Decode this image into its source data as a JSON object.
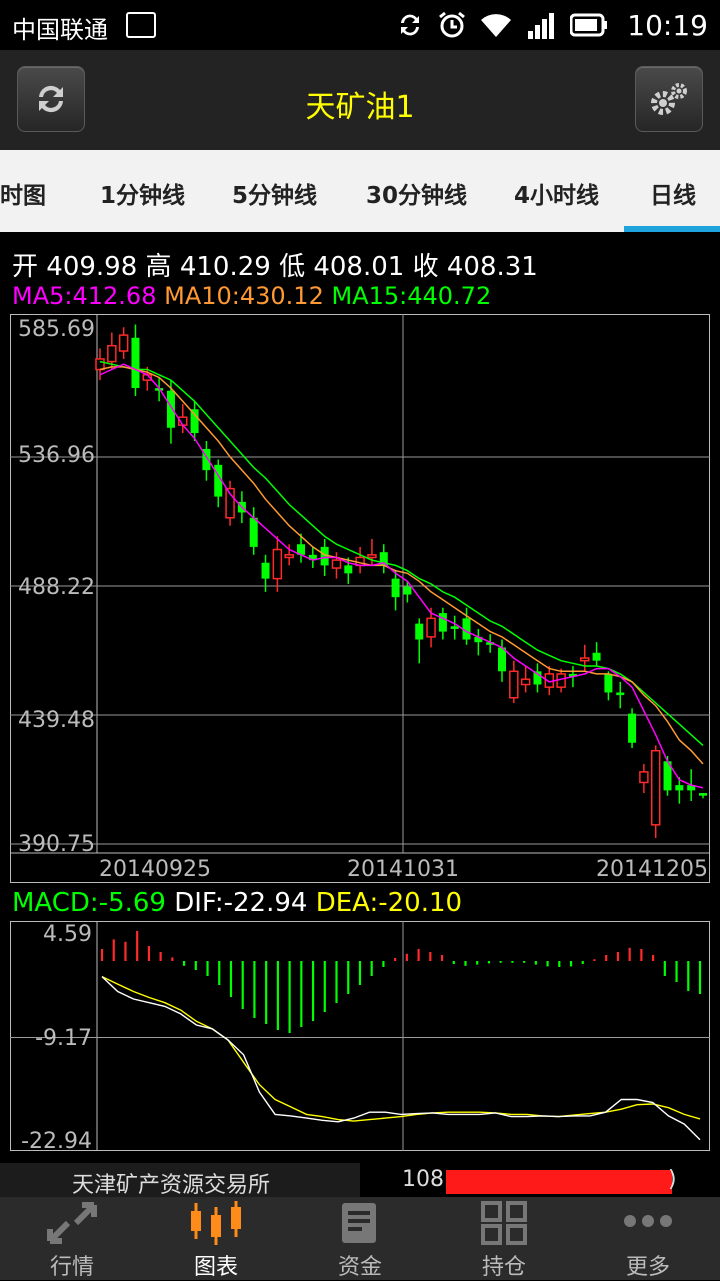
{
  "status_bar": {
    "carrier": "中国联通",
    "time": "10:19"
  },
  "title_bar": {
    "title": "天矿油1",
    "refresh_icon": "refresh-icon",
    "settings_icon": "settings-gear-icon"
  },
  "tabs": [
    {
      "label": "时图"
    },
    {
      "label": "1分钟线"
    },
    {
      "label": "5分钟线"
    },
    {
      "label": "30分钟线"
    },
    {
      "label": "4小时线"
    },
    {
      "label": "日线",
      "active": true
    }
  ],
  "ohlc": {
    "open_label": "开",
    "open": "409.98",
    "high_label": "高",
    "high": "410.29",
    "low_label": "低",
    "low": "408.01",
    "close_label": "收",
    "close": "408.31"
  },
  "ma": {
    "ma5": "MA5:412.68",
    "ma10": "MA10:430.12",
    "ma15": "MA15:440.72",
    "ma5_color": "#ff00ff",
    "ma10_color": "#ff9933",
    "ma15_color": "#00ff00"
  },
  "macd": {
    "macd": "MACD:-5.69",
    "dif": "DIF:-22.94",
    "dea": "DEA:-20.10",
    "macd_color": "#00ff00",
    "dif_color": "#ffffff",
    "dea_color": "#ffff00"
  },
  "chart_data": [
    {
      "type": "candlestick",
      "y_ticks": [
        "585.69",
        "536.96",
        "488.22",
        "439.48",
        "390.75"
      ],
      "ylim": [
        390.75,
        585.69
      ],
      "x_labels": [
        "20140925",
        "20141031",
        "20141205"
      ],
      "up_color": "#ff2a2a",
      "down_color": "#00ff00",
      "candles": [
        {
          "o": 570,
          "c": 574,
          "h": 578,
          "l": 566
        },
        {
          "o": 573,
          "c": 579,
          "h": 584,
          "l": 570
        },
        {
          "o": 577,
          "c": 583,
          "h": 586,
          "l": 574
        },
        {
          "o": 582,
          "c": 563,
          "h": 587,
          "l": 560
        },
        {
          "o": 566,
          "c": 568,
          "h": 571,
          "l": 562
        },
        {
          "o": 563,
          "c": 562,
          "h": 567,
          "l": 558
        },
        {
          "o": 562,
          "c": 548,
          "h": 566,
          "l": 542
        },
        {
          "o": 549,
          "c": 552,
          "h": 557,
          "l": 546
        },
        {
          "o": 555,
          "c": 546,
          "h": 558,
          "l": 543
        },
        {
          "o": 540,
          "c": 532,
          "h": 543,
          "l": 528
        },
        {
          "o": 534,
          "c": 522,
          "h": 536,
          "l": 518
        },
        {
          "o": 514,
          "c": 525,
          "h": 528,
          "l": 511
        },
        {
          "o": 520,
          "c": 516,
          "h": 524,
          "l": 512
        },
        {
          "o": 514,
          "c": 503,
          "h": 518,
          "l": 500
        },
        {
          "o": 497,
          "c": 491,
          "h": 500,
          "l": 486
        },
        {
          "o": 491,
          "c": 502,
          "h": 507,
          "l": 486
        },
        {
          "o": 499,
          "c": 500,
          "h": 504,
          "l": 496
        },
        {
          "o": 504,
          "c": 500,
          "h": 508,
          "l": 497
        },
        {
          "o": 500,
          "c": 498,
          "h": 503,
          "l": 495
        },
        {
          "o": 503,
          "c": 496,
          "h": 506,
          "l": 492
        },
        {
          "o": 495,
          "c": 498,
          "h": 501,
          "l": 491
        },
        {
          "o": 496,
          "c": 493,
          "h": 499,
          "l": 489
        },
        {
          "o": 496,
          "c": 499,
          "h": 503,
          "l": 493
        },
        {
          "o": 499,
          "c": 500,
          "h": 506,
          "l": 496
        },
        {
          "o": 501,
          "c": 496,
          "h": 504,
          "l": 493
        },
        {
          "o": 491,
          "c": 484,
          "h": 494,
          "l": 479
        },
        {
          "o": 488,
          "c": 485,
          "h": 490,
          "l": 482
        },
        {
          "o": 474,
          "c": 468,
          "h": 476,
          "l": 459
        },
        {
          "o": 469,
          "c": 476,
          "h": 480,
          "l": 465
        },
        {
          "o": 478,
          "c": 471,
          "h": 480,
          "l": 468
        },
        {
          "o": 473,
          "c": 472,
          "h": 477,
          "l": 468
        },
        {
          "o": 476,
          "c": 468,
          "h": 480,
          "l": 466
        },
        {
          "o": 469,
          "c": 467,
          "h": 472,
          "l": 462
        },
        {
          "o": 467,
          "c": 466,
          "h": 470,
          "l": 463
        },
        {
          "o": 465,
          "c": 456,
          "h": 468,
          "l": 452
        },
        {
          "o": 446,
          "c": 456,
          "h": 460,
          "l": 444
        },
        {
          "o": 451,
          "c": 453,
          "h": 458,
          "l": 448
        },
        {
          "o": 456,
          "c": 451,
          "h": 459,
          "l": 448
        },
        {
          "o": 450,
          "c": 455,
          "h": 458,
          "l": 447
        },
        {
          "o": 450,
          "c": 455,
          "h": 457,
          "l": 448
        },
        {
          "o": 455,
          "c": 454,
          "h": 458,
          "l": 450
        },
        {
          "o": 460,
          "c": 461,
          "h": 466,
          "l": 456
        },
        {
          "o": 463,
          "c": 460,
          "h": 467,
          "l": 458
        },
        {
          "o": 455,
          "c": 448,
          "h": 456,
          "l": 445
        },
        {
          "o": 448,
          "c": 447,
          "h": 452,
          "l": 442
        },
        {
          "o": 440,
          "c": 429,
          "h": 442,
          "l": 427
        },
        {
          "o": 414,
          "c": 418,
          "h": 421,
          "l": 410
        },
        {
          "o": 398,
          "c": 426,
          "h": 428,
          "l": 393
        },
        {
          "o": 422,
          "c": 411,
          "h": 424,
          "l": 409
        },
        {
          "o": 413,
          "c": 411,
          "h": 416,
          "l": 406
        },
        {
          "o": 413,
          "c": 411,
          "h": 419,
          "l": 407
        },
        {
          "o": 410,
          "c": 409,
          "h": 410,
          "l": 408
        }
      ],
      "ma5": [
        568,
        570,
        572,
        570,
        568,
        563,
        556,
        549,
        544,
        537,
        530,
        523,
        518,
        514,
        510,
        506,
        502,
        500,
        498,
        499,
        499,
        497,
        496,
        496,
        497,
        493,
        490,
        484,
        478,
        476,
        474,
        471,
        469,
        467,
        465,
        461,
        458,
        455,
        452,
        453,
        454,
        455,
        457,
        457,
        454,
        450,
        441,
        432,
        422,
        415,
        413,
        412
      ],
      "ma10": [
        570,
        571,
        571,
        570,
        569,
        567,
        563,
        558,
        553,
        548,
        543,
        537,
        532,
        527,
        521,
        516,
        511,
        507,
        503,
        500,
        499,
        498,
        497,
        496,
        496,
        494,
        493,
        490,
        486,
        483,
        480,
        477,
        474,
        471,
        469,
        466,
        463,
        460,
        457,
        456,
        456,
        456,
        455,
        455,
        454,
        452,
        447,
        443,
        437,
        430,
        426,
        421
      ],
      "ma15": [
        573,
        572,
        571,
        570,
        570,
        568,
        566,
        562,
        558,
        553,
        548,
        543,
        538,
        533,
        529,
        524,
        519,
        515,
        511,
        507,
        504,
        502,
        500,
        498,
        497,
        496,
        494,
        491,
        489,
        486,
        484,
        481,
        478,
        475,
        473,
        470,
        467,
        464,
        462,
        460,
        459,
        458,
        458,
        457,
        455,
        452,
        448,
        444,
        440,
        436,
        432,
        428
      ]
    },
    {
      "type": "macd",
      "y_ticks": [
        "4.59",
        "-9.17",
        "-22.94"
      ],
      "ylim": [
        -22.94,
        4.59
      ],
      "bars": [
        2.0,
        3.6,
        3.2,
        5.0,
        2.5,
        1.5,
        0.6,
        -0.8,
        -1.5,
        -2.5,
        -4.0,
        -6.0,
        -8.0,
        -9.5,
        -10.5,
        -11.5,
        -12.0,
        -11.0,
        -10.0,
        -8.5,
        -7.0,
        -5.5,
        -4.0,
        -2.5,
        -1.0,
        0.5,
        1.2,
        2.0,
        1.5,
        1.0,
        -0.5,
        -0.8,
        -0.6,
        -0.4,
        -0.3,
        -0.3,
        -0.3,
        -0.6,
        -0.9,
        -1.0,
        -0.9,
        -0.5,
        0.3,
        1.0,
        1.5,
        2.2,
        2.0,
        1.0,
        -2.5,
        -3.5,
        -5.0,
        -5.5
      ],
      "dif": [
        -1,
        -3,
        -4,
        -4.5,
        -5,
        -6,
        -7.5,
        -8,
        -9.5,
        -11.5,
        -16.5,
        -19.5,
        -19.7,
        -20,
        -20.3,
        -20.5,
        -20,
        -19.2,
        -19.2,
        -19.5,
        -19.4,
        -19.3,
        -19.5,
        -19.5,
        -19.5,
        -19.3,
        -19.8,
        -19.8,
        -19.7,
        -19.8,
        -19.7,
        -19.7,
        -19.2,
        -17.5,
        -17.5,
        -17.9,
        -19.7,
        -20.8,
        -22.9
      ],
      "dea": [
        -1,
        -2,
        -3,
        -3.8,
        -4.5,
        -5.5,
        -7,
        -8,
        -9.5,
        -12.5,
        -15.5,
        -17.5,
        -18.5,
        -19.5,
        -19.8,
        -20.2,
        -20.4,
        -20.2,
        -20.0,
        -19.8,
        -19.5,
        -19.3,
        -19.2,
        -19.2,
        -19.2,
        -19.3,
        -19.5,
        -19.5,
        -19.7,
        -19.8,
        -19.6,
        -19.4,
        -19.2,
        -18.8,
        -18.2,
        -18.1,
        -18.6,
        -19.5,
        -20.1
      ],
      "grid": true
    }
  ],
  "bottom_symbol": {
    "exchange": "天津矿产资源交易所",
    "code_prefix": "108",
    "code_suffix": ")"
  },
  "nav": [
    {
      "label": "行情",
      "icon": "market-arrows-icon"
    },
    {
      "label": "图表",
      "icon": "candlestick-chart-icon",
      "active": true
    },
    {
      "label": "资金",
      "icon": "funds-book-icon"
    },
    {
      "label": "持仓",
      "icon": "positions-grid-icon"
    },
    {
      "label": "更多",
      "icon": "more-dots-icon"
    }
  ]
}
